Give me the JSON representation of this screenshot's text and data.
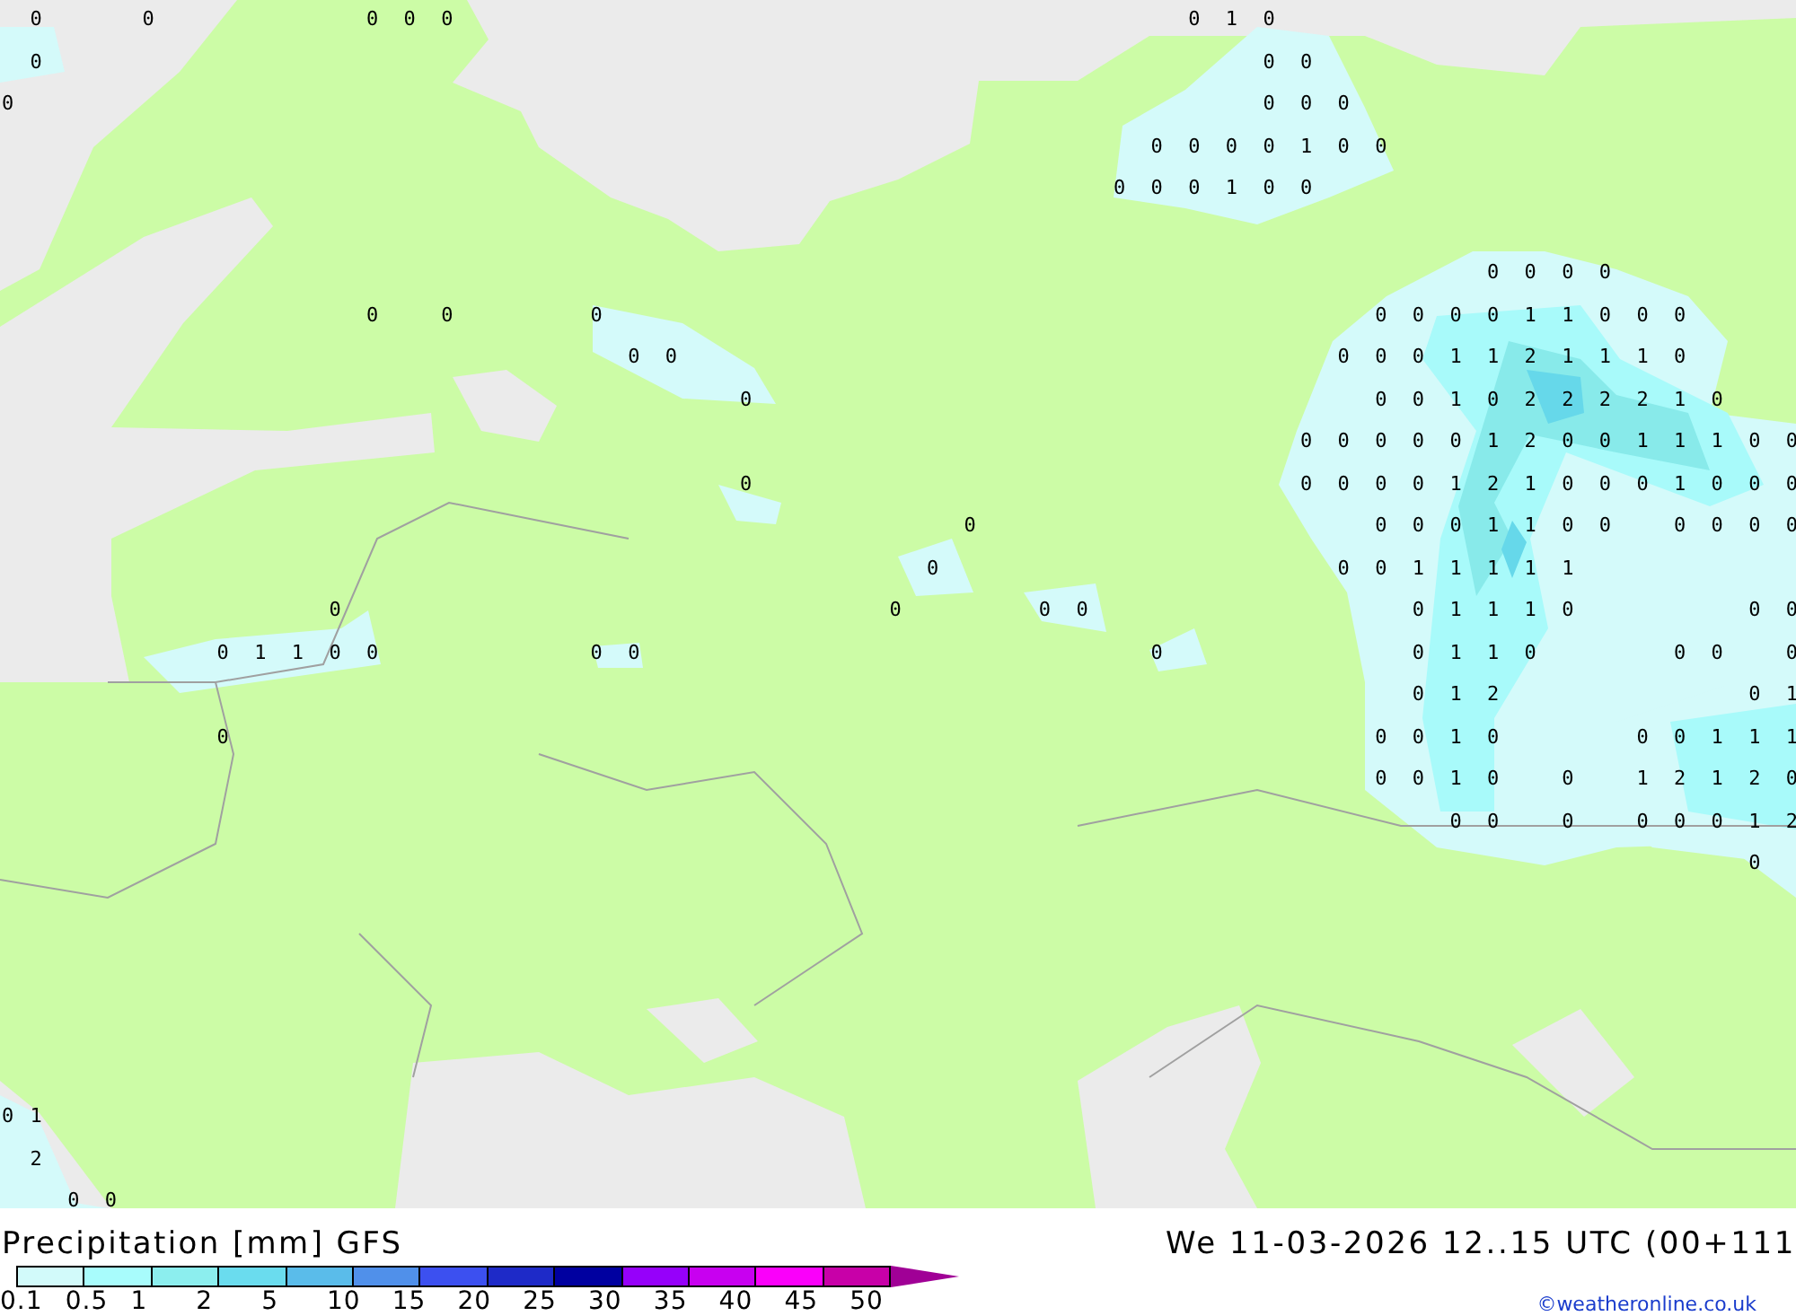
{
  "map": {
    "value_rows": [
      [
        null,
        "0",
        null,
        null,
        "0",
        null,
        null,
        null,
        null,
        null,
        "0",
        "0",
        "0",
        null,
        null,
        null,
        null,
        null,
        null,
        null,
        null,
        null,
        null,
        null,
        null,
        null,
        null,
        null,
        null,
        null,
        null,
        null,
        "0",
        "1",
        "0"
      ],
      [
        null,
        "0",
        null,
        null,
        null,
        null,
        null,
        null,
        null,
        null,
        null,
        null,
        null,
        null,
        null,
        null,
        null,
        null,
        null,
        null,
        null,
        null,
        null,
        null,
        null,
        null,
        null,
        null,
        null,
        null,
        null,
        null,
        null,
        null,
        "0",
        "0"
      ],
      [
        "0",
        null,
        null,
        null,
        null,
        null,
        null,
        null,
        null,
        null,
        null,
        null,
        null,
        null,
        null,
        null,
        null,
        null,
        null,
        null,
        null,
        null,
        null,
        null,
        null,
        null,
        null,
        null,
        null,
        null,
        null,
        null,
        null,
        null,
        "0",
        "0",
        "0"
      ],
      [
        null,
        null,
        null,
        null,
        null,
        null,
        null,
        null,
        null,
        null,
        null,
        null,
        null,
        null,
        null,
        null,
        null,
        null,
        null,
        null,
        null,
        null,
        null,
        null,
        null,
        null,
        null,
        null,
        null,
        null,
        null,
        "0",
        "0",
        "0",
        "0",
        "1",
        "0",
        "0"
      ],
      [
        null,
        null,
        null,
        null,
        null,
        null,
        null,
        null,
        null,
        null,
        null,
        null,
        null,
        null,
        null,
        null,
        null,
        null,
        null,
        null,
        null,
        null,
        null,
        null,
        null,
        null,
        null,
        null,
        null,
        null,
        "0",
        "0",
        "0",
        "1",
        "0",
        "0"
      ],
      [
        null
      ],
      [
        null,
        null,
        null,
        null,
        null,
        null,
        null,
        null,
        null,
        null,
        null,
        null,
        null,
        null,
        null,
        null,
        null,
        null,
        null,
        null,
        null,
        null,
        null,
        null,
        null,
        null,
        null,
        null,
        null,
        null,
        null,
        null,
        null,
        null,
        null,
        null,
        null,
        null,
        null,
        null,
        "0",
        "0",
        "0",
        "0"
      ],
      [
        null,
        null,
        null,
        null,
        null,
        null,
        null,
        null,
        null,
        null,
        "0",
        null,
        "0",
        null,
        null,
        null,
        "0",
        null,
        null,
        null,
        null,
        null,
        null,
        null,
        null,
        null,
        null,
        null,
        null,
        null,
        null,
        null,
        null,
        null,
        null,
        null,
        null,
        "0",
        "0",
        "0",
        "0",
        "1",
        "1",
        "0",
        "0",
        "0"
      ],
      [
        null,
        null,
        null,
        null,
        null,
        null,
        null,
        null,
        null,
        null,
        null,
        null,
        null,
        null,
        null,
        null,
        null,
        "0",
        "0",
        null,
        null,
        null,
        null,
        null,
        null,
        null,
        null,
        null,
        null,
        null,
        null,
        null,
        null,
        null,
        null,
        null,
        "0",
        "0",
        "0",
        "1",
        "1",
        "2",
        "1",
        "1",
        "1",
        "0"
      ],
      [
        null,
        null,
        null,
        null,
        null,
        null,
        null,
        null,
        null,
        null,
        null,
        null,
        null,
        null,
        null,
        null,
        null,
        null,
        null,
        null,
        "0",
        null,
        null,
        null,
        null,
        null,
        null,
        null,
        null,
        null,
        null,
        null,
        null,
        null,
        null,
        null,
        null,
        "0",
        "0",
        "1",
        "0",
        "2",
        "2",
        "2",
        "2",
        "1",
        "0"
      ],
      [
        null,
        null,
        null,
        null,
        null,
        null,
        null,
        null,
        null,
        null,
        null,
        null,
        null,
        null,
        null,
        null,
        null,
        null,
        null,
        null,
        null,
        null,
        null,
        null,
        null,
        null,
        null,
        null,
        null,
        null,
        null,
        null,
        null,
        null,
        null,
        "0",
        "0",
        "0",
        "0",
        "0",
        "1",
        "2",
        "0",
        "0",
        "1",
        "1",
        "1",
        "0",
        "0"
      ],
      [
        null,
        null,
        null,
        null,
        null,
        null,
        null,
        null,
        null,
        null,
        null,
        null,
        null,
        null,
        null,
        null,
        null,
        null,
        null,
        null,
        "0",
        null,
        null,
        null,
        null,
        null,
        null,
        null,
        null,
        null,
        null,
        null,
        null,
        null,
        null,
        "0",
        "0",
        "0",
        "0",
        "1",
        "2",
        "1",
        "0",
        "0",
        "0",
        "1",
        "0",
        "0",
        "0"
      ],
      [
        null,
        null,
        null,
        null,
        null,
        null,
        null,
        null,
        null,
        null,
        null,
        null,
        null,
        null,
        null,
        null,
        null,
        null,
        null,
        null,
        null,
        null,
        null,
        null,
        null,
        null,
        "0",
        null,
        null,
        null,
        null,
        null,
        null,
        null,
        null,
        null,
        null,
        "0",
        "0",
        "0",
        "1",
        "1",
        "0",
        "0",
        null,
        "0",
        "0",
        "0",
        "0"
      ],
      [
        null,
        null,
        null,
        null,
        null,
        null,
        null,
        null,
        null,
        null,
        null,
        null,
        null,
        null,
        null,
        null,
        null,
        null,
        null,
        null,
        null,
        null,
        null,
        null,
        null,
        "0",
        null,
        null,
        null,
        null,
        null,
        null,
        null,
        null,
        null,
        null,
        "0",
        "0",
        "1",
        "1",
        "1",
        "1",
        "1"
      ],
      [
        null,
        null,
        null,
        null,
        null,
        null,
        null,
        null,
        null,
        "0",
        null,
        null,
        null,
        null,
        null,
        null,
        null,
        null,
        null,
        null,
        null,
        null,
        null,
        null,
        "0",
        null,
        null,
        null,
        "0",
        "0",
        null,
        null,
        null,
        null,
        null,
        null,
        null,
        null,
        "0",
        "1",
        "1",
        "1",
        "0",
        null,
        null,
        null,
        null,
        "0",
        "0"
      ],
      [
        null,
        null,
        null,
        null,
        null,
        null,
        "0",
        "1",
        "1",
        "0",
        "0",
        null,
        null,
        null,
        null,
        null,
        "0",
        "0",
        null,
        null,
        null,
        null,
        null,
        null,
        null,
        null,
        null,
        null,
        null,
        null,
        null,
        "0",
        null,
        null,
        null,
        null,
        null,
        null,
        "0",
        "1",
        "1",
        "0",
        null,
        null,
        null,
        "0",
        "0",
        null,
        "0"
      ],
      [
        null,
        null,
        null,
        null,
        null,
        null,
        null,
        null,
        null,
        null,
        null,
        null,
        null,
        null,
        null,
        null,
        null,
        null,
        null,
        null,
        null,
        null,
        null,
        null,
        null,
        null,
        null,
        null,
        null,
        null,
        null,
        null,
        null,
        null,
        null,
        null,
        null,
        null,
        "0",
        "1",
        "2",
        null,
        null,
        null,
        null,
        null,
        null,
        "0",
        "1"
      ],
      [
        null,
        null,
        null,
        null,
        null,
        null,
        "0",
        null,
        null,
        null,
        null,
        null,
        null,
        null,
        null,
        null,
        null,
        null,
        null,
        null,
        null,
        null,
        null,
        null,
        null,
        null,
        null,
        null,
        null,
        null,
        null,
        null,
        null,
        null,
        null,
        null,
        null,
        "0",
        "0",
        "1",
        "0",
        null,
        null,
        null,
        "0",
        "0",
        "1",
        "1",
        "1"
      ],
      [
        null,
        null,
        null,
        null,
        null,
        null,
        null,
        null,
        null,
        null,
        null,
        null,
        null,
        null,
        null,
        null,
        null,
        null,
        null,
        null,
        null,
        null,
        null,
        null,
        null,
        null,
        null,
        null,
        null,
        null,
        null,
        null,
        null,
        null,
        null,
        null,
        null,
        "0",
        "0",
        "1",
        "0",
        null,
        "0",
        null,
        "1",
        "2",
        "1",
        "2",
        "0"
      ],
      [
        null,
        null,
        null,
        null,
        null,
        null,
        null,
        null,
        null,
        null,
        null,
        null,
        null,
        null,
        null,
        null,
        null,
        null,
        null,
        null,
        null,
        null,
        null,
        null,
        null,
        null,
        null,
        null,
        null,
        null,
        null,
        null,
        null,
        null,
        null,
        null,
        null,
        null,
        null,
        "0",
        "0",
        null,
        "0",
        null,
        "0",
        "0",
        "0",
        "1",
        "2"
      ],
      [
        null,
        null,
        null,
        null,
        null,
        null,
        null,
        null,
        null,
        null,
        null,
        null,
        null,
        null,
        null,
        null,
        null,
        null,
        null,
        null,
        null,
        null,
        null,
        null,
        null,
        null,
        null,
        null,
        null,
        null,
        null,
        null,
        null,
        null,
        null,
        null,
        null,
        null,
        null,
        null,
        null,
        null,
        null,
        null,
        null,
        null,
        null,
        "0"
      ],
      [
        null
      ],
      [
        null
      ],
      [
        null
      ],
      [
        null
      ],
      [
        null
      ],
      [
        "0",
        "1"
      ],
      [
        null,
        "2"
      ],
      [
        null,
        null,
        "0",
        "0"
      ]
    ]
  },
  "legend": {
    "title": "Precipitation [mm] GFS",
    "timestamp": "We 11-03-2026 12..15 UTC (00+111",
    "credit": "©weatheronline.co.uk",
    "swatches": [
      {
        "color": "#d2fafa"
      },
      {
        "color": "#a8fcfc"
      },
      {
        "color": "#8ceeee"
      },
      {
        "color": "#6adcee"
      },
      {
        "color": "#5abcea"
      },
      {
        "color": "#5090ea"
      },
      {
        "color": "#3c50f0"
      },
      {
        "color": "#1e2ac8"
      },
      {
        "color": "#0000a0"
      },
      {
        "color": "#9600fa"
      },
      {
        "color": "#c800f0"
      },
      {
        "color": "#fa00fa"
      },
      {
        "color": "#c800a8"
      }
    ],
    "ticks": [
      "0.1",
      "0.5",
      "1",
      "2",
      "5",
      "10",
      "15",
      "20",
      "25",
      "30",
      "35",
      "40",
      "45",
      "50"
    ]
  }
}
